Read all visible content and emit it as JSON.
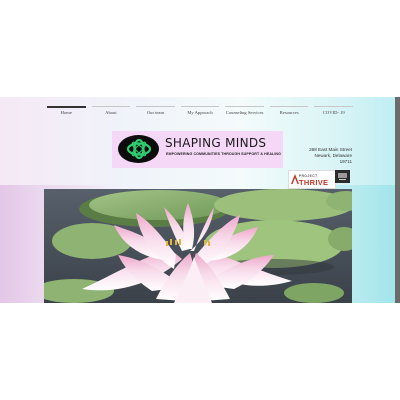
{
  "nav": {
    "items": [
      {
        "label": "Home",
        "active": true
      },
      {
        "label": "About"
      },
      {
        "label": "Our team"
      },
      {
        "label": "My Approach"
      },
      {
        "label": "Counseling Services"
      },
      {
        "label": "Resources"
      },
      {
        "label": "COVID- 19"
      }
    ]
  },
  "logo": {
    "title": "SHAPING MINDS",
    "tagline": "EMPOWERING COMMUNITIES THROUGH SUPPORT & HEALING",
    "icon": "infinity-knot-icon",
    "colors": {
      "box": "#f5d8f7",
      "circle": "#0c0c0c",
      "symbol": "#2ecc71"
    }
  },
  "address": {
    "street": "288 East Main Street",
    "city": "Newark, Delaware",
    "zip": "19711"
  },
  "badge": {
    "line1": "PROJECT",
    "line2": "THRIVE"
  },
  "hero": {
    "subject": "lotus-flower-image",
    "colors": {
      "water": "#4a5560",
      "pad": "#8fb372",
      "petal": "#f2c6dc",
      "center": "#e7b43a"
    }
  }
}
